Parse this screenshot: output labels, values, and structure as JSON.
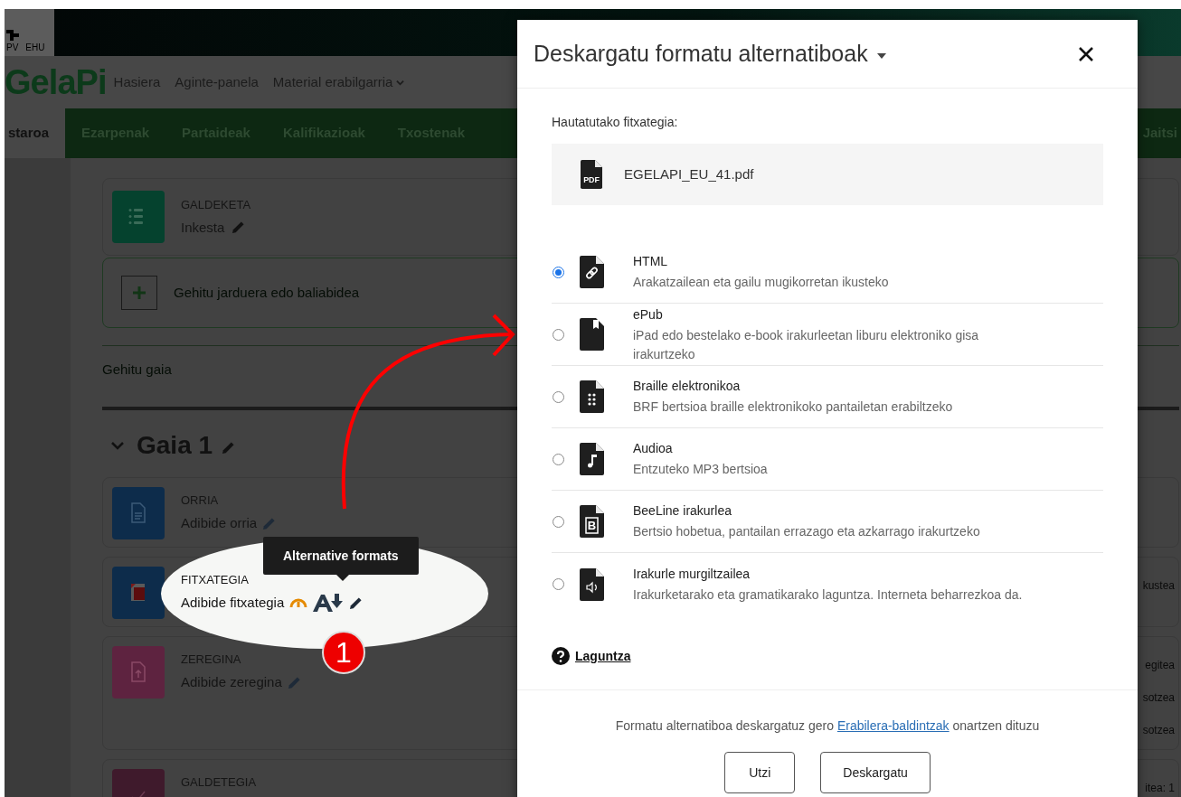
{
  "banner": {
    "logo_texts": [
      "PV",
      "EHU"
    ]
  },
  "nav": {
    "brand": "GelaPi",
    "links": [
      {
        "label": "Hasiera",
        "dropdown": false
      },
      {
        "label": "Aginte-panela",
        "dropdown": false
      },
      {
        "label": "Material erabilgarria",
        "dropdown": true
      }
    ]
  },
  "tabs": [
    {
      "label": "staroa",
      "selected": true
    },
    {
      "label": "Ezarpenak",
      "selected": false
    },
    {
      "label": "Partaideak",
      "selected": false
    },
    {
      "label": "Kalifikazioak",
      "selected": false
    },
    {
      "label": "Txostenak",
      "selected": false
    }
  ],
  "tabs_right": {
    "label": "Jaitsi"
  },
  "top_activity": {
    "type": "GALDEKETA",
    "name": "Inkesta",
    "kind": "survey",
    "color": "#05422e"
  },
  "add_activity": {
    "label": "Gehitu jarduera edo baliabidea"
  },
  "add_topic": {
    "label": "Gehitu gaia"
  },
  "section": {
    "title": "Gaia 1",
    "expanded": true,
    "activities": [
      {
        "type": "ORRIA",
        "name": "Adibide orria",
        "kind": "page",
        "color": "#0d2c4b"
      },
      {
        "type": "FITXATEGIA",
        "name": "Adibide fitxategia",
        "kind": "file",
        "color": "#0d2c4b",
        "notes": [
          "kustea"
        ],
        "accessibility": true
      },
      {
        "type": "ZEREGINA",
        "name": "Adibide zeregina",
        "kind": "assignment",
        "color": "#5e2340",
        "notes": [
          "egitea",
          "sotzea",
          "sotzea"
        ]
      },
      {
        "type": "GALDETEGIA",
        "kind": "quiz",
        "color": "#3f1a2c",
        "notes": [
          "itea: 1"
        ]
      }
    ]
  },
  "callout": {
    "tooltip": "Alternative formats",
    "badge": "1"
  },
  "dialog": {
    "title": "Deskargatu formatu alternatiboak",
    "file_label": "Hautatutako fitxategia:",
    "file": {
      "name": "EGELAPI_EU_41.pdf",
      "icon_label": "PDF"
    },
    "options": [
      {
        "kind": "link",
        "title": "HTML",
        "description": "Arakatzailean eta gailu mugikorretan ikusteko",
        "selected": true
      },
      {
        "kind": "book",
        "title": "ePub",
        "description": "iPad edo bestelako e-book irakurleetan liburu elektroniko gisa irakurtzeko",
        "selected": false
      },
      {
        "kind": "braille",
        "title": "Braille elektronikoa",
        "description": "BRF bertsioa braille elektronikoko pantailetan erabiltzeko",
        "selected": false
      },
      {
        "kind": "audio",
        "title": "Audioa",
        "description": "Entzuteko MP3 bertsioa",
        "selected": false
      },
      {
        "kind": "beeline",
        "title": "BeeLine irakurlea",
        "description": "Bertsio hobetua, pantailan errazago eta azkarrago irakurtzeko",
        "selected": false,
        "icon_label": "B"
      },
      {
        "kind": "speaker",
        "title": "Irakurle murgiltzailea",
        "description": "Irakurketarako eta gramatikarako laguntza. Interneta beharrezkoa da.",
        "selected": false
      }
    ],
    "help": "Laguntza",
    "terms": {
      "before": "Formatu alternatiboa deskargatuz gero",
      "link": "Erabilera-baldintzak",
      "after": "onartzen dituzu"
    },
    "buttons": [
      "Utzi",
      "Deskargatu"
    ]
  }
}
